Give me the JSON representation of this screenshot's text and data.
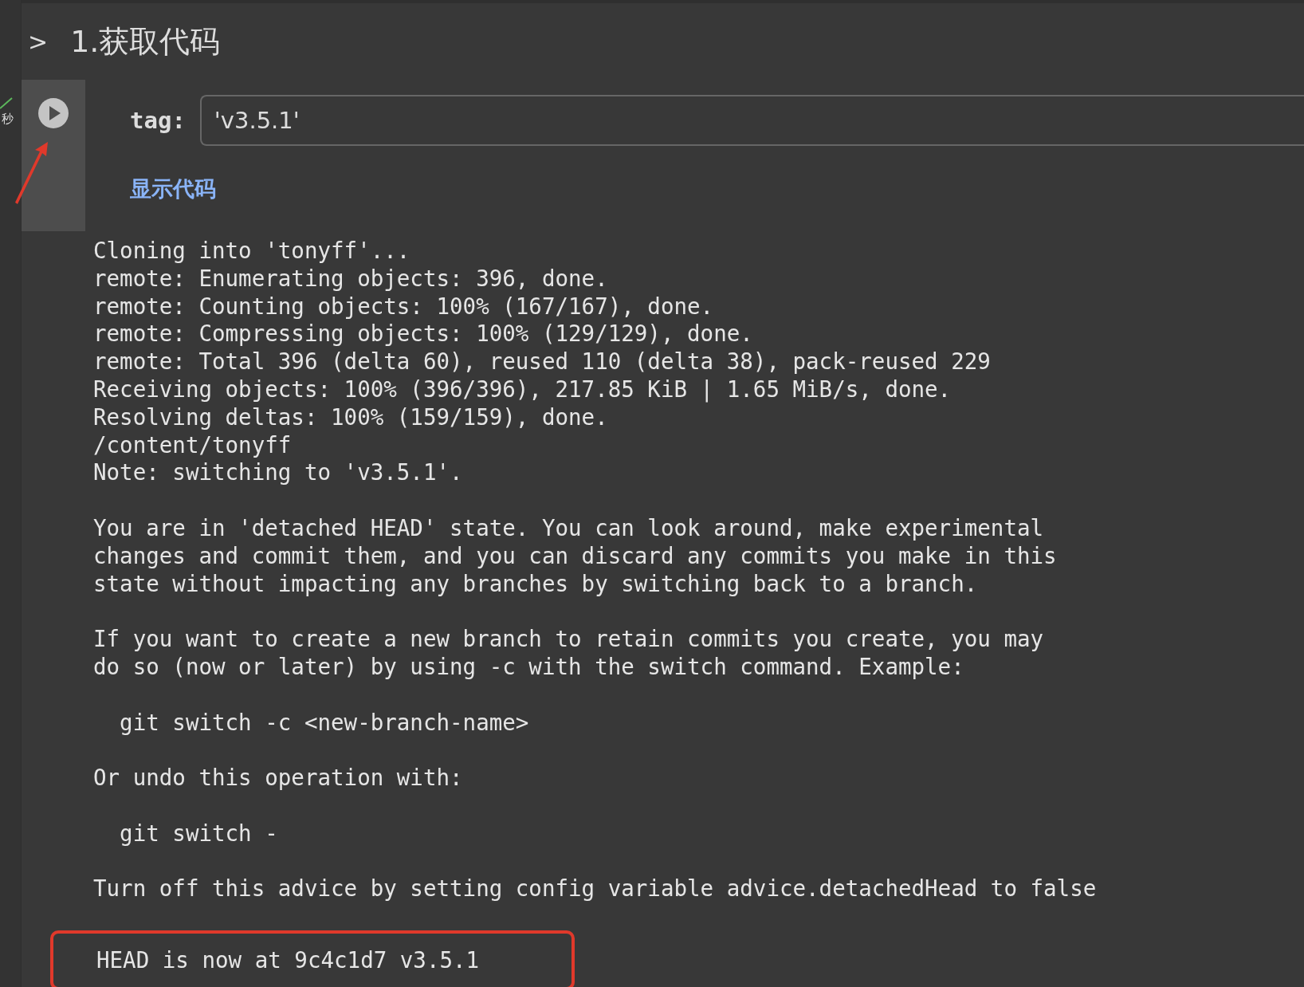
{
  "section": {
    "toggle": ">",
    "title": "1.获取代码",
    "expanded": false
  },
  "cell": {
    "exec_time": "秒",
    "field_label": "tag:",
    "field_value": "'v3.5.1'",
    "link": "显示代码"
  },
  "output": {
    "blocks": [
      [
        "Cloning into 'tonyff'...",
        "remote: Enumerating objects: 396, done.",
        "remote: Counting objects: 100% (167/167), done.",
        "remote: Compressing objects: 100% (129/129), done.",
        "remote: Total 396 (delta 60), reused 110 (delta 38), pack-reused 229",
        "Receiving objects: 100% (396/396), 217.85 KiB | 1.65 MiB/s, done.",
        "Resolving deltas: 100% (159/159), done.",
        "/content/tonyff",
        "Note: switching to 'v3.5.1'."
      ],
      [
        "You are in 'detached HEAD' state. You can look around, make experimental",
        "changes and commit them, and you can discard any commits you make in this",
        "state without impacting any branches by switching back to a branch."
      ],
      [
        "If you want to create a new branch to retain commits you create, you may",
        "do so (now or later) by using -c with the switch command. Example:"
      ],
      [
        "  git switch -c <new-branch-name>"
      ],
      [
        "Or undo this operation with:"
      ],
      [
        "  git switch -"
      ],
      [
        "Turn off this advice by setting config variable advice.detachedHead to false"
      ]
    ],
    "highlighted_line": "HEAD is now at 9c4c1d7 v3.5.1"
  }
}
